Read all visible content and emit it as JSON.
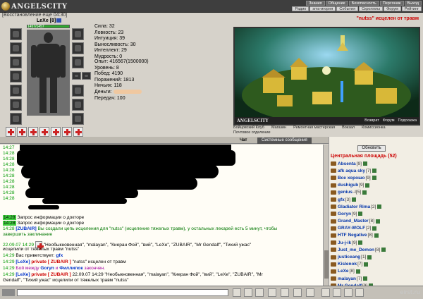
{
  "app": {
    "logo_text": "ANGELSCITY",
    "menu_top": [
      "Знания",
      "Общение",
      "Безопасность",
      "Персонаж",
      "Выход"
    ],
    "menu_bottom": [
      "Радио",
      "sms-игорня",
      "События",
      "Скролллы",
      "Форум",
      "Рейтинг"
    ]
  },
  "character": {
    "restore_text": "[Восстановление еще 04:30]",
    "nick": "LeXe",
    "level": "[8]",
    "hp_text": "1457/1457",
    "hp_fraction": 1.0,
    "stats": [
      "Сила: 32",
      "Ловкость: 23",
      "Интуиция: 39",
      "Выносливость: 30",
      "Интеллект: 29",
      "Мудрость: 0"
    ],
    "stats2": [
      "Опыт: 416567(1500000)",
      "Уровень: 8",
      "Побед: 4190",
      "Поражений: 1813",
      "Ничьих: 118",
      "Деньги:",
      "Передач: 100"
    ]
  },
  "location": {
    "healed_notice": "\"nutss\" исцелен от травм",
    "scene_brand": "ANGELSCITY",
    "scene_links": [
      "Возврат",
      "Форум",
      "Подсказка"
    ],
    "places": [
      "Бойцовский Клуб",
      "Магазин",
      "Ремонтная мастерская",
      "Вокзал",
      "Комиссионка",
      "Почтовое отделение"
    ]
  },
  "chat": {
    "tab_all": "Чат",
    "tab_system": "Системные сообщения",
    "lines": [
      {
        "time": "14:27",
        "text": ""
      },
      {
        "time": "14:28",
        "text": ""
      },
      {
        "time": "14:28",
        "text": ""
      },
      {
        "time": "14:28",
        "text": ""
      },
      {
        "time": "14:28",
        "text": ""
      },
      {
        "time": "14:28",
        "text": ""
      },
      {
        "time": "14:28",
        "text": ""
      },
      {
        "time": "14:28",
        "text": ""
      },
      {
        "time": "14:28",
        "text": ""
      },
      {
        "time": "14:28",
        "text": ""
      }
    ],
    "doctor_line_1_time": "14:28",
    "doctor_line_1": "Запрос информации о докторе",
    "doctor_line_2_time": "14:28",
    "doctor_line_2": "Запрос информации о докторе",
    "zubair_time": "14:28",
    "zubair_tag": "[ZUBAIR]",
    "zubair_text": "Вы создали цепь исцеления для \"nutss\" (исцеление тяжелых травм), у остальных лекарей есть 5 минут, чтобы",
    "zubair_text2": "завершить заклинание",
    "date_time": "22.09.07 14:29",
    "heal_text": "\"Необыкновенная\", \"malayan\", \"Киеран Фой\", \"вий\", \"LeXe\", \"ZUBAIR\", \"Mr Gendalf\", \"Тихий ужас\"",
    "heal_text2": "исцелили от тяжелых травм \"nutss\"",
    "greet_time": "14:29",
    "greet_text": "Вас приветствует:",
    "greet_name": "gfx",
    "priv_time": "14:29",
    "priv_tag": "[LeXe]",
    "priv_label": "private [ ZUBAIR ]",
    "priv_text": "\"nutss\" исцелен от травм",
    "fight_time": "14:29",
    "fight_text1": "Бой между",
    "fight_name1": "Goryn",
    "fight_and": "и",
    "fight_name2": "Филлипок",
    "fight_text2": "закончен.",
    "priv2_time": "14:29",
    "priv2_tag": "[LeXe]",
    "priv2_label": "private [ ZUBAIR ]",
    "priv2_date": "22.09.07 14:29",
    "priv2_text": "\"Необыкновенная\", \"malayan\", \"Киеран Фой\", \"вий\", \"LeXe\", \"ZUBAIR\", \"Mr",
    "priv2_text2": "Gendalf\", \"Тихий ужас\" исцелили от тяжелых травм \"nutss\""
  },
  "userlist": {
    "refresh_label": "Обновить",
    "location_title": "Центральная площадь (52)",
    "users": [
      {
        "name": "Absenta",
        "level": "[9]"
      },
      {
        "name": "afk aqua sky",
        "level": "[7]"
      },
      {
        "name": "Все хорошо",
        "level": "[9]"
      },
      {
        "name": "dushigub",
        "level": "[9]"
      },
      {
        "name": "genius",
        "level": "-I[5]"
      },
      {
        "name": "gfx",
        "level": "[3]"
      },
      {
        "name": "Gladiator Rima",
        "level": "[2]"
      },
      {
        "name": "Goryn",
        "level": "[9]"
      },
      {
        "name": "Grand_Master",
        "level": "[8]"
      },
      {
        "name": "GRAY-WOLF",
        "level": "[2]"
      },
      {
        "name": "HTF Negative",
        "level": "[8]"
      },
      {
        "name": "Ju-j-ik",
        "level": "[9]"
      },
      {
        "name": "Just_me_Demon",
        "level": "[8]"
      },
      {
        "name": "justiceang",
        "level": "[1]"
      },
      {
        "name": "Kislenok",
        "level": "[7]"
      },
      {
        "name": "LeXe",
        "level": "[8]"
      },
      {
        "name": "malayan",
        "level": "[7]"
      },
      {
        "name": "Mr Gendalf",
        "level": "[9]"
      },
      {
        "name": "Mu xa",
        "level": "[7]"
      }
    ]
  },
  "watermark": "eirst.ru"
}
